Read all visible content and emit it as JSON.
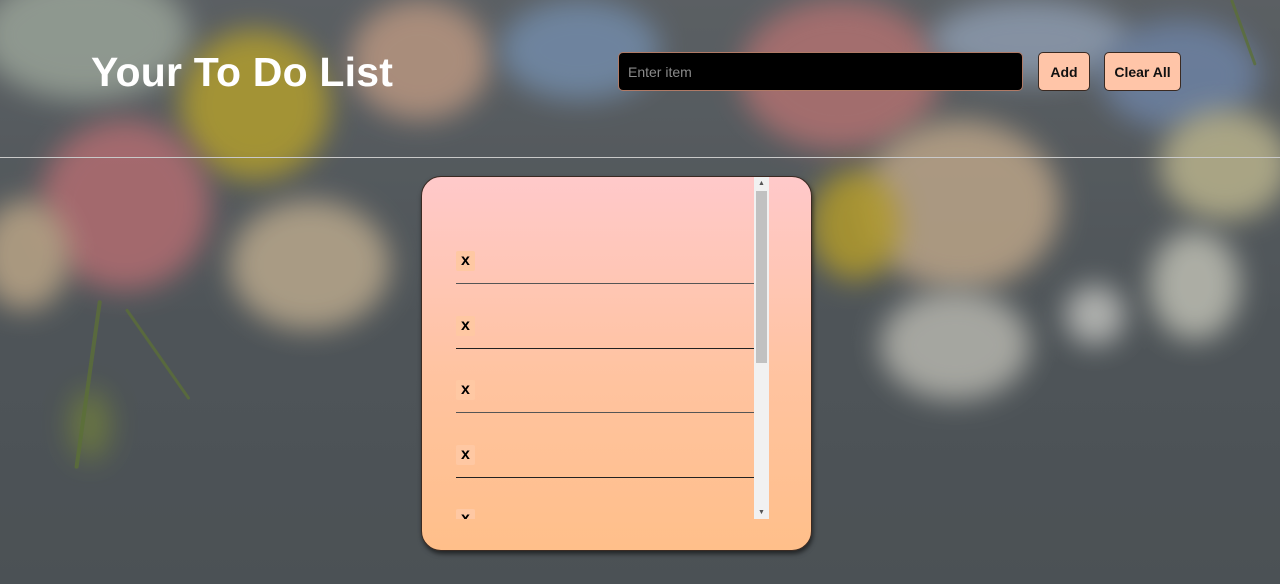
{
  "header": {
    "title": "Your To Do List",
    "input": {
      "placeholder": "Enter item",
      "value": ""
    },
    "add_label": "Add",
    "clear_label": "Clear All"
  },
  "todo_list": {
    "items": [
      {
        "delete_label": "x",
        "text": ""
      },
      {
        "delete_label": "x",
        "text": ""
      },
      {
        "delete_label": "x",
        "text": ""
      },
      {
        "delete_label": "x",
        "text": ""
      },
      {
        "delete_label": "x",
        "text": ""
      }
    ],
    "scroll_position": 0
  },
  "colors": {
    "button": "#ffc5a8",
    "card_top": "#ffc9ca",
    "card_bottom": "#ffbf8a",
    "input_bg": "#000000",
    "title_text": "#ffffff"
  },
  "icons": {
    "scroll_up": "triangle-up-icon",
    "scroll_down": "triangle-down-icon"
  }
}
